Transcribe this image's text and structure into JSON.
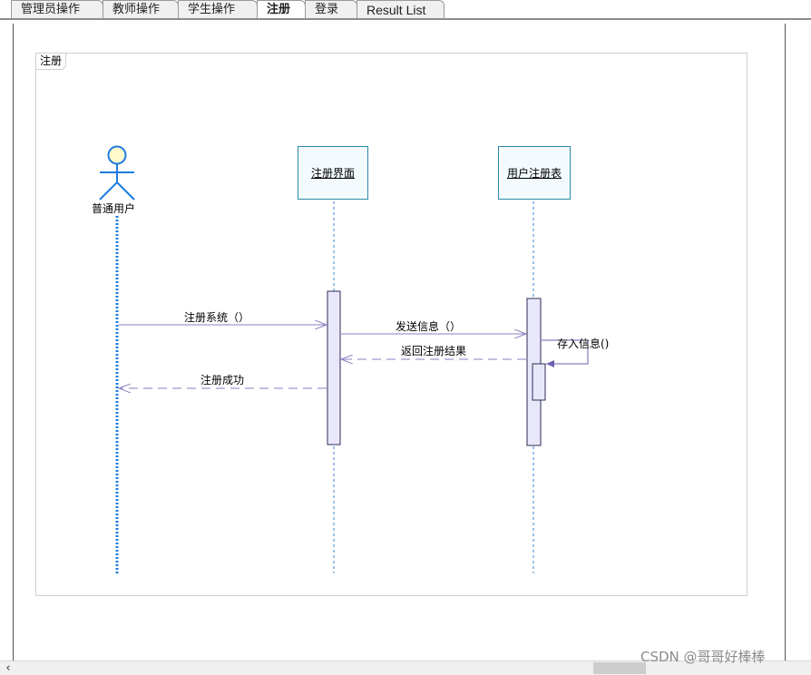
{
  "tabs": [
    {
      "label": "管理员操作",
      "active": false
    },
    {
      "label": "教师操作",
      "active": false
    },
    {
      "label": "学生操作",
      "active": false
    },
    {
      "label": "注册",
      "active": true
    },
    {
      "label": "登录",
      "active": false
    },
    {
      "label": "Result List",
      "active": false
    }
  ],
  "frame": {
    "label": "注册"
  },
  "diagram": {
    "actor": {
      "label": "普通用户"
    },
    "lifelines": [
      {
        "label": "注册界面"
      },
      {
        "label": "用户注册表"
      }
    ],
    "messages": [
      {
        "label": "注册系统（）",
        "from": "普通用户",
        "to": "注册界面",
        "kind": "sync"
      },
      {
        "label": "发送信息（）",
        "from": "注册界面",
        "to": "用户注册表",
        "kind": "sync"
      },
      {
        "label": "存入信息()",
        "from": "用户注册表",
        "to": "用户注册表",
        "kind": "self"
      },
      {
        "label": "返回注册结果",
        "from": "用户注册表",
        "to": "注册界面",
        "kind": "return"
      },
      {
        "label": "注册成功",
        "from": "注册界面",
        "to": "普通用户",
        "kind": "return"
      }
    ]
  },
  "watermark": "CSDN @哥哥好棒棒",
  "colors": {
    "lifeline": "#3a86d4",
    "activation_fill": "#e6e6fa",
    "message": "#8a7fc0",
    "box_border": "#2a8aa8"
  }
}
